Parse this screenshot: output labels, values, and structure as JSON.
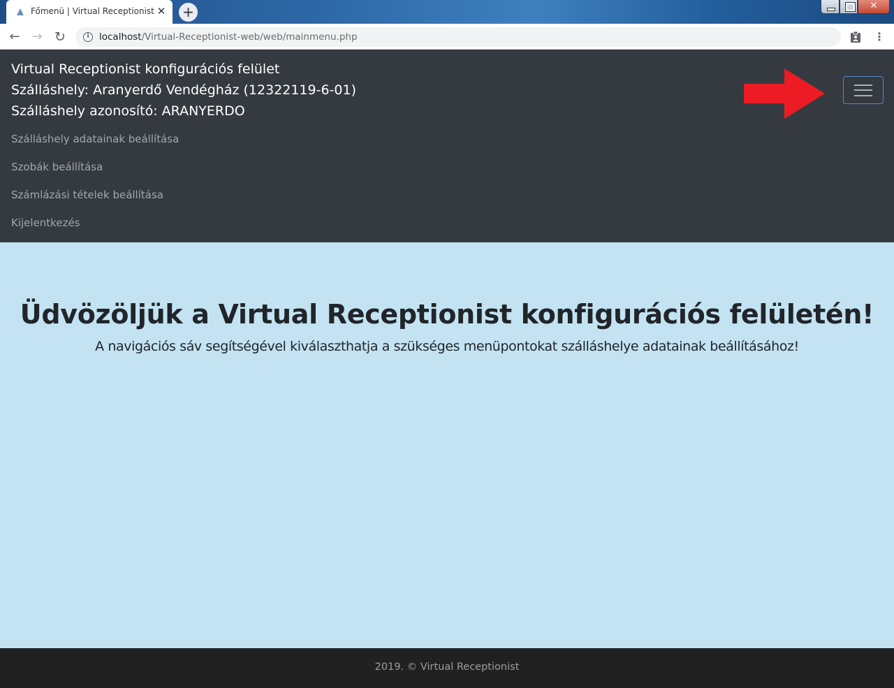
{
  "browser": {
    "tab_title": "Főmenü | Virtual Receptionist",
    "tab_close_glyph": "✕",
    "new_tab_glyph": "+",
    "url_host": "localhost",
    "url_path": "/Virtual-Receptionist-web/web/mainmenu.php",
    "info_glyph": "i",
    "back_glyph": "←",
    "forward_glyph": "→",
    "reload_glyph": "↻",
    "menu_glyph": "⋮"
  },
  "navbar": {
    "brand_line1": "Virtual Receptionist konfigurációs felület",
    "brand_line2": "Szálláshely: Aranyerdő Vendégház (12322119-6-01)",
    "brand_line3": "Szálláshely azonosító: ARANYERDO",
    "links": [
      {
        "label": "Szálláshely adatainak beállítása"
      },
      {
        "label": "Szobák beállítása"
      },
      {
        "label": "Számlázási tételek beállítása"
      },
      {
        "label": "Kijelentkezés"
      }
    ],
    "toggler_icon": "hamburger-icon",
    "annotation_color": "#ed1c24"
  },
  "main": {
    "title": "Üdvözöljük a Virtual Receptionist konfigurációs felületén!",
    "subtitle": "A navigációs sáv segítségével kiválaszthatja a szükséges menüpontokat szálláshelye adatainak beállításához!"
  },
  "footer": {
    "text": "2019. © Virtual Receptionist"
  },
  "colors": {
    "navbar_bg": "#343a40",
    "page_bg": "#c3e3f3",
    "footer_bg": "#212121"
  }
}
